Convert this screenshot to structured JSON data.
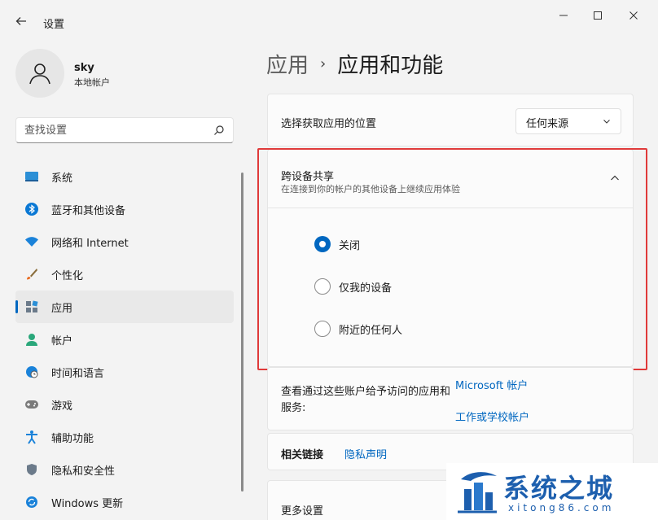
{
  "window": {
    "title": "设置"
  },
  "profile": {
    "name": "sky",
    "account_type": "本地帐户"
  },
  "search": {
    "placeholder": "查找设置"
  },
  "sidebar": {
    "items": [
      {
        "label": "系统",
        "icon": "system-icon"
      },
      {
        "label": "蓝牙和其他设备",
        "icon": "bluetooth-icon"
      },
      {
        "label": "网络和 Internet",
        "icon": "wifi-icon"
      },
      {
        "label": "个性化",
        "icon": "brush-icon"
      },
      {
        "label": "应用",
        "icon": "apps-icon",
        "active": true
      },
      {
        "label": "帐户",
        "icon": "person-icon"
      },
      {
        "label": "时间和语言",
        "icon": "globe-clock-icon"
      },
      {
        "label": "游戏",
        "icon": "gamepad-icon"
      },
      {
        "label": "辅助功能",
        "icon": "accessibility-icon"
      },
      {
        "label": "隐私和安全性",
        "icon": "shield-icon"
      },
      {
        "label": "Windows 更新",
        "icon": "update-icon"
      }
    ]
  },
  "breadcrumb": {
    "parent": "应用",
    "separator": "›",
    "current": "应用和功能"
  },
  "app_location": {
    "label": "选择获取应用的位置",
    "selected": "任何来源"
  },
  "share": {
    "title": "跨设备共享",
    "description": "在连接到你的帐户的其他设备上继续应用体验",
    "options": [
      {
        "label": "关闭",
        "checked": true
      },
      {
        "label": "仅我的设备",
        "checked": false
      },
      {
        "label": "附近的任何人",
        "checked": false
      }
    ]
  },
  "accounts": {
    "description": "查看通过这些账户给予访问的应用和服务:",
    "link_microsoft": "Microsoft 帐户",
    "link_work": "工作或学校帐户"
  },
  "related": {
    "label": "相关链接",
    "privacy_link": "隐私声明"
  },
  "more": {
    "label": "更多设置"
  },
  "watermark": {
    "text": "系统之城",
    "url": "xitong86.com"
  },
  "colors": {
    "accent": "#0067c0",
    "highlight": "#e03a3a"
  }
}
